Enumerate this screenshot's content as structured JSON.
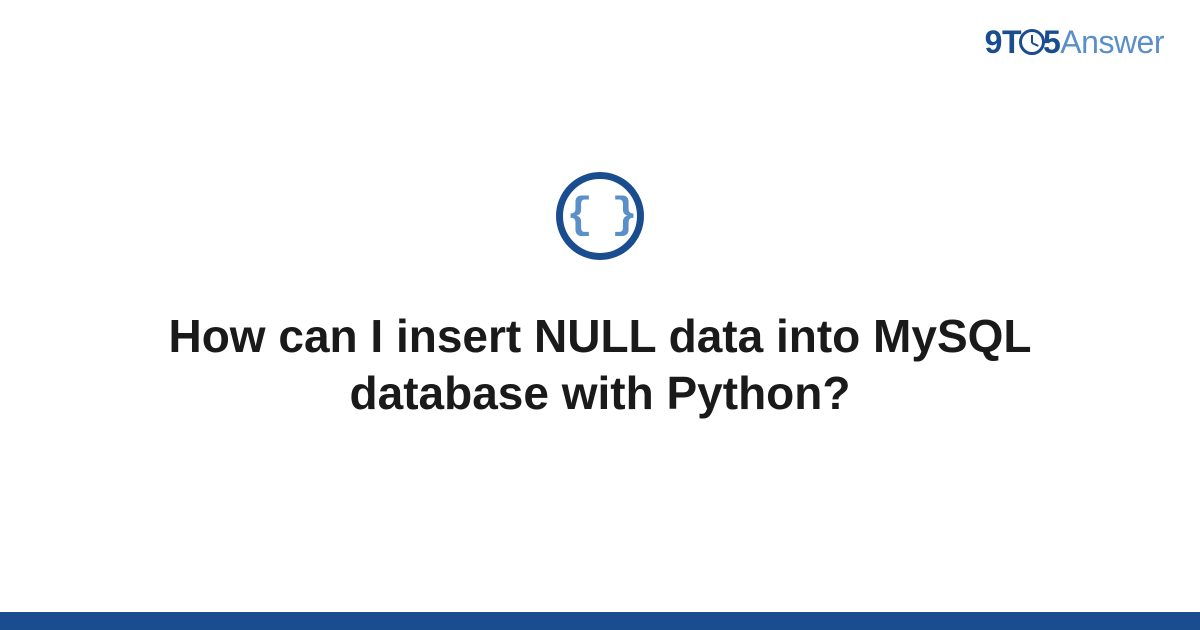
{
  "logo": {
    "part1": "9T",
    "part2": "5",
    "part3": "Answer"
  },
  "icon": {
    "content": "{ }"
  },
  "title": "How can I insert NULL data into MySQL database with Python?"
}
